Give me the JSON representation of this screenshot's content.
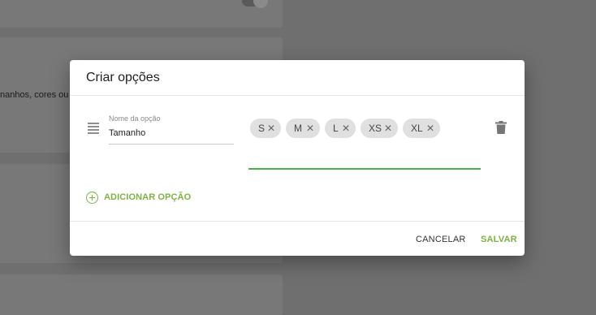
{
  "background": {
    "partial_text": "nanhos, cores ou"
  },
  "dialog": {
    "title": "Criar opções",
    "option": {
      "name_label": "Nome da opção",
      "name_value": "Tamanho",
      "values": [
        "S",
        "M",
        "L",
        "XS",
        "XL"
      ],
      "remove_symbol": "✕"
    },
    "add_option_label": "ADICIONAR OPÇÃO",
    "cancel_label": "CANCELAR",
    "save_label": "SALVAR"
  },
  "colors": {
    "accent": "#7cb342",
    "input_focus": "#4caf50",
    "overlay": "#6f6f6f"
  }
}
